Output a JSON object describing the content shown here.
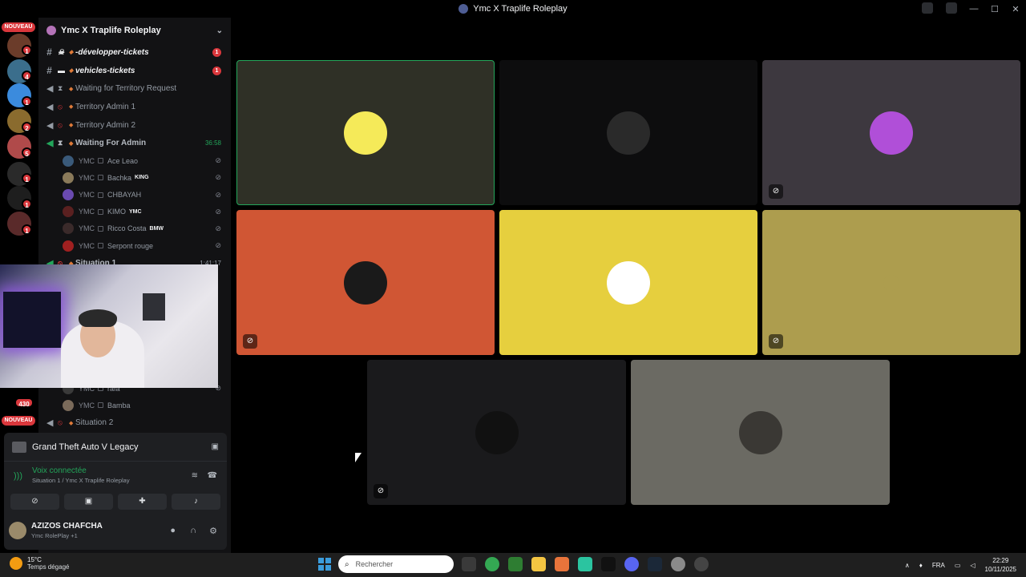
{
  "window": {
    "title": "Ymc X Traplife Roleplay"
  },
  "serverbar": {
    "new_badge": "NOUVEAU",
    "new_badge_2": "NOUVEAU",
    "badges": [
      "1",
      "4",
      "1",
      "2",
      "5",
      "1",
      "1",
      "1"
    ],
    "cw_label": "CW",
    "count_430": "430"
  },
  "guild": {
    "name": "Ymc X Traplife Roleplay"
  },
  "channels": [
    {
      "name": "-développer-tickets",
      "badge": "1"
    },
    {
      "name": "vehicles-tickets",
      "badge": "1"
    },
    {
      "name": "Waiting for Territory Request"
    },
    {
      "name": "Territory Admin 1"
    },
    {
      "name": "Territory Admin 2"
    },
    {
      "name": "Waiting For Admin",
      "timer": "36:58"
    }
  ],
  "members": [
    {
      "tag": "YMC",
      "name": "Ace Leao",
      "role": ""
    },
    {
      "tag": "YMC",
      "name": "Bachka",
      "role": "KING"
    },
    {
      "tag": "YMC",
      "name": "CHBAYAH",
      "role": ""
    },
    {
      "tag": "YMC",
      "name": "KIMO",
      "role": "YMC"
    },
    {
      "tag": "YMC",
      "name": "Ricco Costa",
      "role": "BMW"
    },
    {
      "tag": "YMC",
      "name": "Serpont rouge",
      "role": ""
    }
  ],
  "situation1": {
    "name": "Situation 1",
    "timer": "1:41:17"
  },
  "members_below": [
    {
      "tag": "YMC",
      "name": "rafa"
    },
    {
      "tag": "YMC",
      "name": "Bamba"
    }
  ],
  "situation2": {
    "name": "Situation 2"
  },
  "activity": {
    "game": "Grand Theft Auto V Legacy"
  },
  "voice": {
    "status": "Voix connectée",
    "location": "Situation 1 / Ymc X Traplife Roleplay"
  },
  "user": {
    "name": "AZIZOS CHAFCHA",
    "status": "Ymc RolePlay",
    "status_extra": "+1"
  },
  "tiles": [
    {
      "label": "tile-1",
      "bg": "#2f3026",
      "avatar_bg": "#f5ea59",
      "speaking": true,
      "muted": false
    },
    {
      "label": "tile-2",
      "bg": "#0d0d0e",
      "avatar_bg": "#2a2a2a",
      "speaking": false,
      "muted": false
    },
    {
      "label": "tile-3",
      "bg": "#3d383f",
      "avatar_bg": "#b04fd8",
      "speaking": false,
      "muted": true
    },
    {
      "label": "tile-4",
      "bg": "#d05634",
      "avatar_bg": "#1a1a1a",
      "speaking": false,
      "muted": true
    },
    {
      "label": "tile-5",
      "bg": "#e6cf3e",
      "avatar_bg": "#ffffff",
      "speaking": false,
      "muted": false
    },
    {
      "label": "tile-6",
      "bg": "#ad9d4e",
      "avatar_bg": "#ad9d4e",
      "speaking": false,
      "muted": true
    },
    {
      "label": "tile-7",
      "bg": "#1a1a1c",
      "avatar_bg": "#111111",
      "speaking": false,
      "muted": true
    },
    {
      "label": "tile-8",
      "bg": "#6b6a63",
      "avatar_bg": "#3a3834",
      "speaking": false,
      "muted": false
    }
  ],
  "taskbar": {
    "temperature": "15°C",
    "weather": "Temps dégagé",
    "search_placeholder": "Rechercher",
    "lang": "FRA",
    "time": "22:29",
    "date": "10/11/2025"
  },
  "colors": {
    "accent_green": "#23a55a",
    "badge_red": "#da373c",
    "channel_bg": "#121214"
  }
}
